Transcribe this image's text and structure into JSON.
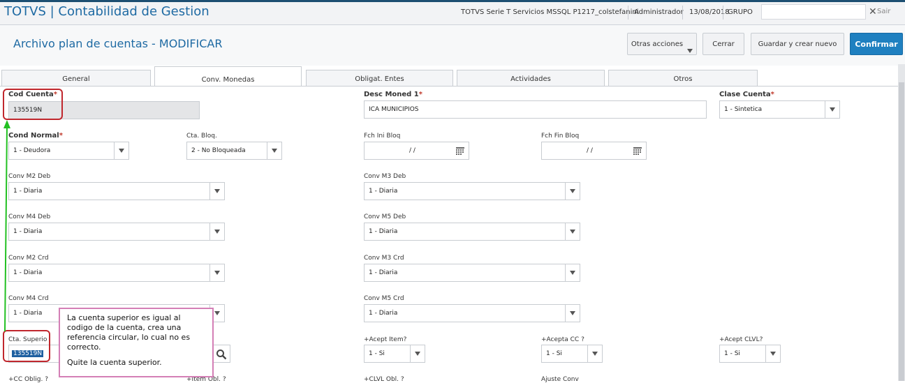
{
  "header": {
    "brand": "TOTVS | Contabilidad de Gestion",
    "server": "TOTVS Serie T Servicios MSSQL P1217_colstefanini",
    "user": "Administrador",
    "date": "13/08/2018",
    "grupo_label": "GRUPO",
    "exit_label": "Sair"
  },
  "page": {
    "title": "Archivo plan de cuentas - MODIFICAR"
  },
  "actions": {
    "more": "Otras acciones",
    "close": "Cerrar",
    "save_new": "Guardar y crear nuevo",
    "confirm": "Confirmar"
  },
  "tabs": [
    "General",
    "Conv. Monedas",
    "Obligat. Entes",
    "Actividades",
    "Otros"
  ],
  "active_tab": "Conv. Monedas",
  "fields": {
    "cod_cuenta": {
      "label": "Cod Cuenta",
      "value": "135519N"
    },
    "desc_moned1": {
      "label": "Desc Moned 1",
      "value": "ICA MUNICIPIOS"
    },
    "clase_cuenta": {
      "label": "Clase Cuenta",
      "value": "1 - Sintetica"
    },
    "cond_normal": {
      "label": "Cond Normal",
      "value": "1 - Deudora"
    },
    "cta_bloq": {
      "label": "Cta. Bloq.",
      "value": "2 - No Bloqueada"
    },
    "fch_ini_bloq": {
      "label": "Fch Ini Bloq",
      "value": "/ /"
    },
    "fch_fin_bloq": {
      "label": "Fch Fin Bloq",
      "value": "/ /"
    },
    "conv_m2_deb": {
      "label": "Conv M2 Deb",
      "value": "1 - Diaria"
    },
    "conv_m3_deb": {
      "label": "Conv M3 Deb",
      "value": "1 - Diaria"
    },
    "conv_m4_deb": {
      "label": "Conv M4 Deb",
      "value": "1 - Diaria"
    },
    "conv_m5_deb": {
      "label": "Conv M5 Deb",
      "value": "1 - Diaria"
    },
    "conv_m2_crd": {
      "label": "Conv M2 Crd",
      "value": "1 - Diaria"
    },
    "conv_m3_crd": {
      "label": "Conv M3 Crd",
      "value": "1 - Diaria"
    },
    "conv_m4_crd": {
      "label": "Conv M4 Crd",
      "value": "1 - Diaria"
    },
    "conv_m5_crd": {
      "label": "Conv M5 Crd",
      "value": "1 - Diaria"
    },
    "cta_superior": {
      "label": "Cta. Superio",
      "value": "135519N"
    },
    "acept_item": {
      "label": "+Acept Item?",
      "value": "1 - Si"
    },
    "acepta_cc": {
      "label": "+Acepta CC ?",
      "value": "1 - Si"
    },
    "acept_clvl": {
      "label": "+Acept CLVL?",
      "value": "1 - Si"
    },
    "cc_oblig": {
      "label": "+CC Oblig. ?"
    },
    "item_obl": {
      "label": "+Item Obl. ?"
    },
    "clvl_obl": {
      "label": "+CLVL Obl. ?"
    },
    "ajuste_conv": {
      "label": "Ajuste Conv"
    }
  },
  "callout": {
    "line1": "La cuenta superior es igual al codigo de la cuenta, crea una referencia circular, lo cual no es correcto.",
    "line2": "Quite la cuenta superior."
  },
  "colors": {
    "accent": "#1e6aa3",
    "confirm": "#1f80c0",
    "annotation_box": "#c0272d",
    "annotation_arrow": "#22c022",
    "callout_border": "#d47fb6"
  }
}
